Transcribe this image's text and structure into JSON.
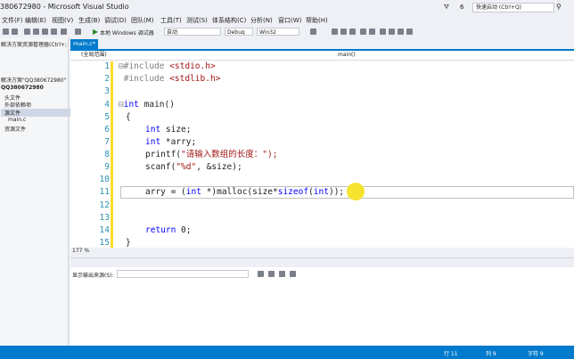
{
  "window": {
    "title": "380672980 - Microsoft Visual Studio",
    "search_placeholder": "快速启动 (Ctrl+Q)",
    "notif_count": "6"
  },
  "menu": [
    "文件(F)",
    "编辑(E)",
    "视图(V)",
    "生成(B)",
    "调试(D)",
    "团队(M)",
    "工具(T)",
    "测试(S)",
    "体系结构(C)",
    "分析(N)",
    "窗口(W)",
    "帮助(H)"
  ],
  "toolbar": {
    "run_label": "本地 Windows 调试器",
    "run_mode": "自动",
    "config": "Debug",
    "platform": "Win32"
  },
  "sidebar": {
    "lines": [
      "解决方案资源管理器(Ctrl+;)",
      "解决方案\"QQ380672980\"(1 个项目)",
      "QQ380672980",
      "头文件",
      "外部依赖项",
      "源文件",
      "main.c",
      "资源文件"
    ]
  },
  "editor": {
    "tab": "main.c*",
    "nav_left": "(全局范围)",
    "nav_right": "main()",
    "zoom": "177 %"
  },
  "output": {
    "label": "显示输出来源(S):"
  },
  "status": {
    "line": "行 11",
    "col": "列 9",
    "char": "字符 9"
  }
}
